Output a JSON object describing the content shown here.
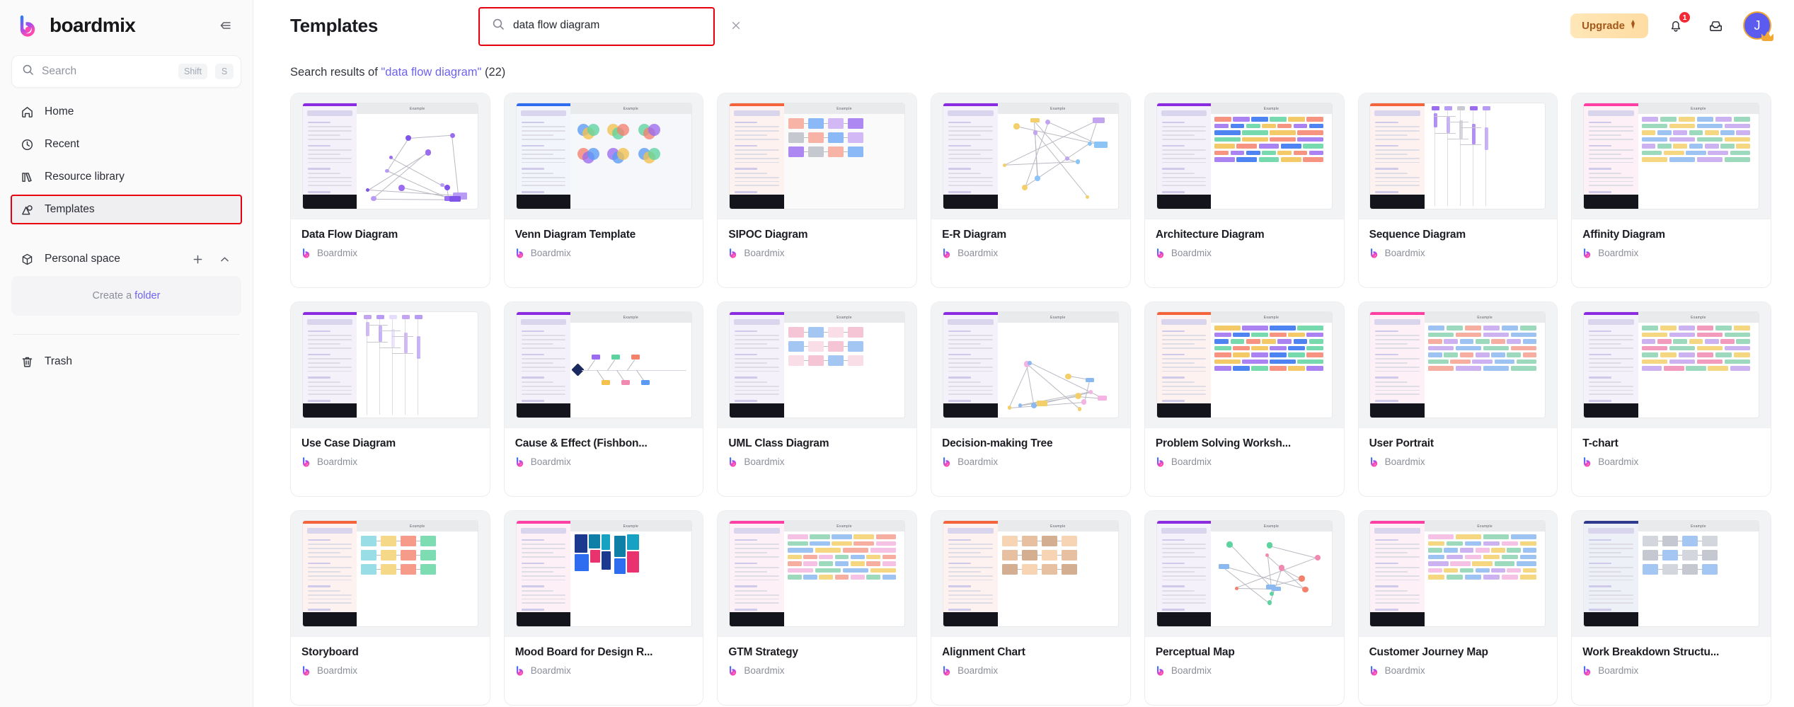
{
  "sidebar": {
    "brand": "boardmix",
    "collapse_icon": "collapse-panel-icon",
    "search": {
      "placeholder": "Search",
      "icon": "search-icon",
      "shortcut_keys": [
        "Shift",
        "S"
      ]
    },
    "nav": [
      {
        "label": "Home",
        "icon": "home-icon",
        "active": false
      },
      {
        "label": "Recent",
        "icon": "clock-icon",
        "active": false
      },
      {
        "label": "Resource library",
        "icon": "book-icon",
        "active": false
      },
      {
        "label": "Templates",
        "icon": "templates-icon",
        "active": true
      }
    ],
    "personal_space": {
      "label": "Personal space",
      "icon": "cube-icon",
      "add_icon": "plus-icon",
      "collapse_icon": "chevron-up-icon"
    },
    "create_folder": {
      "prefix": "Create a",
      "link": "folder"
    },
    "trash": {
      "label": "Trash",
      "icon": "trash-icon"
    }
  },
  "header": {
    "title": "Templates",
    "search": {
      "value": "data flow diagram",
      "icon": "search-icon",
      "clear_icon": "close-icon"
    },
    "upgrade": {
      "label": "Upgrade",
      "icon": "diamond-icon"
    },
    "notifications": {
      "icon": "bell-icon",
      "count": "1"
    },
    "inbox": {
      "icon": "inbox-icon"
    },
    "avatar": {
      "initial": "J",
      "badge_icon": "crown-icon"
    }
  },
  "results": {
    "prefix": "Search results of",
    "query": "\"data flow diagram\"",
    "count": "(22)"
  },
  "author_label": "Boardmix",
  "templates": [
    {
      "title": "Data Flow Diagram",
      "author": "Boardmix",
      "style": "dfd"
    },
    {
      "title": "Venn Diagram Template",
      "author": "Boardmix",
      "style": "venn"
    },
    {
      "title": "SIPOC Diagram",
      "author": "Boardmix",
      "style": "sipoc"
    },
    {
      "title": "E-R Diagram",
      "author": "Boardmix",
      "style": "er"
    },
    {
      "title": "Architecture Diagram",
      "author": "Boardmix",
      "style": "arch"
    },
    {
      "title": "Sequence Diagram",
      "author": "Boardmix",
      "style": "seq"
    },
    {
      "title": "Affinity Diagram",
      "author": "Boardmix",
      "style": "affinity"
    },
    {
      "title": "Use Case Diagram",
      "author": "Boardmix",
      "style": "usecase"
    },
    {
      "title": "Cause & Effect (Fishbon...",
      "author": "Boardmix",
      "style": "fishbone"
    },
    {
      "title": "UML Class Diagram",
      "author": "Boardmix",
      "style": "uml"
    },
    {
      "title": "Decision-making Tree",
      "author": "Boardmix",
      "style": "tree"
    },
    {
      "title": "Problem Solving Worksh...",
      "author": "Boardmix",
      "style": "worksheet"
    },
    {
      "title": "User Portrait",
      "author": "Boardmix",
      "style": "portrait"
    },
    {
      "title": "T-chart",
      "author": "Boardmix",
      "style": "tchart"
    },
    {
      "title": "Storyboard",
      "author": "Boardmix",
      "style": "storyboard"
    },
    {
      "title": "Mood Board for Design R...",
      "author": "Boardmix",
      "style": "moodboard"
    },
    {
      "title": "GTM Strategy",
      "author": "Boardmix",
      "style": "gtm"
    },
    {
      "title": "Alignment Chart",
      "author": "Boardmix",
      "style": "alignment"
    },
    {
      "title": "Perceptual Map",
      "author": "Boardmix",
      "style": "perceptual"
    },
    {
      "title": "Customer Journey Map",
      "author": "Boardmix",
      "style": "journey"
    },
    {
      "title": "Work Breakdown Structu...",
      "author": "Boardmix",
      "style": "wbs"
    }
  ],
  "colors": {
    "accent": "#6d63ef",
    "highlight_outline": "#e8000f",
    "upgrade_bg": "#ffdca2",
    "badge": "#f02b36",
    "avatar": "#5b5bf0"
  }
}
